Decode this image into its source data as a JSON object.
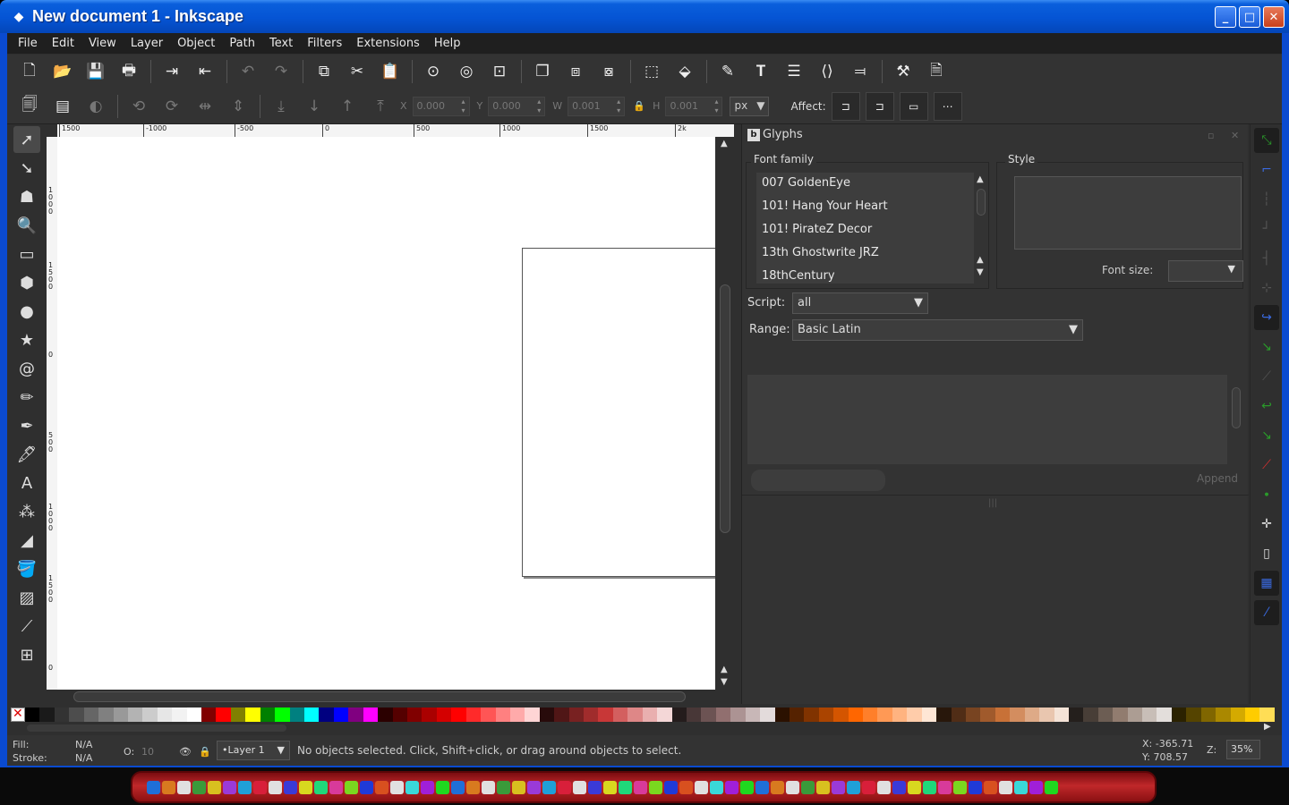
{
  "window": {
    "title": "New document 1 - Inkscape",
    "minimize": "_",
    "maximize": "□",
    "close": "✕"
  },
  "menu": [
    "File",
    "Edit",
    "View",
    "Layer",
    "Object",
    "Path",
    "Text",
    "Filters",
    "Extensions",
    "Help"
  ],
  "toolbar_main": [
    "new-icon",
    "open-icon",
    "save-icon",
    "print-icon",
    "import-icon",
    "export-icon",
    "undo-icon",
    "redo-icon",
    "copy-icon",
    "cut-icon",
    "paste-icon",
    "zoom-selection-icon",
    "zoom-drawing-icon",
    "zoom-page-icon",
    "duplicate-icon",
    "clone-icon",
    "unlink-clone-icon",
    "group-icon",
    "ungroup-icon",
    "fill-stroke-icon",
    "text-font-icon",
    "layers-icon",
    "xml-editor-icon",
    "align-icon",
    "preferences-icon",
    "document-properties-icon"
  ],
  "select_toolbar": {
    "x_label": "X",
    "x_value": "0.000",
    "y_label": "Y",
    "y_value": "0.000",
    "w_label": "W",
    "w_value": "0.001",
    "h_label": "H",
    "h_value": "0.001",
    "unit": "px",
    "affect_label": "Affect:"
  },
  "ruler": {
    "h_labels": [
      "1500",
      "-1000",
      "-500",
      "0",
      "500",
      "1000",
      "1500",
      "2k"
    ],
    "v_labels": [
      "1000",
      "1500",
      "0",
      "500",
      "1000",
      "1500",
      "0"
    ]
  },
  "glyphs": {
    "title": "Glyphs",
    "font_family_label": "Font family",
    "style_label": "Style",
    "fonts": [
      "007 GoldenEye",
      "101! Hang Your Heart",
      "101! PirateZ Decor",
      "13th Ghostwrite JRZ",
      "18thCentury"
    ],
    "font_size_label": "Font size:",
    "script_label": "Script:",
    "script_value": "all",
    "range_label": "Range:",
    "range_value": "Basic Latin",
    "append_label": "Append"
  },
  "status": {
    "fill_label": "Fill:",
    "fill_value": "N/A",
    "stroke_label": "Stroke:",
    "stroke_value": "N/A",
    "opacity_label": "O:",
    "opacity_value": "10",
    "layer": "•Layer 1",
    "message": "No objects selected. Click, Shift+click, or drag around objects to select.",
    "x_coord": "X: -365.71",
    "y_coord": "Y: 708.57",
    "zoom_label": "Z:",
    "zoom_value": "35%"
  },
  "palette": [
    "#000000",
    "#1a1a1a",
    "#333333",
    "#4d4d4d",
    "#666666",
    "#808080",
    "#999999",
    "#b3b3b3",
    "#cccccc",
    "#e6e6e6",
    "#f2f2f2",
    "#ffffff",
    "#800000",
    "#ff0000",
    "#808000",
    "#ffff00",
    "#008000",
    "#00ff00",
    "#008080",
    "#00ffff",
    "#000080",
    "#0000ff",
    "#800080",
    "#ff00ff",
    "#2b0000",
    "#550000",
    "#800000",
    "#aa0000",
    "#d40000",
    "#ff0000",
    "#ff2a2a",
    "#ff5555",
    "#ff8080",
    "#ffaaaa",
    "#ffd5d5",
    "#280b0b",
    "#501616",
    "#782121",
    "#a02c2c",
    "#c83737",
    "#d35f5f",
    "#de8787",
    "#e9afaf",
    "#f4d7d7",
    "#241c1c",
    "#483737",
    "#6c5353",
    "#916f6f",
    "#ac9393",
    "#c8b7b7",
    "#e3dbdb",
    "#2b1100",
    "#552200",
    "#803300",
    "#aa4400",
    "#d45500",
    "#ff6600",
    "#ff7f2a",
    "#ff9955",
    "#ffb380",
    "#ffccaa",
    "#ffe6d5",
    "#28170b",
    "#502d16",
    "#784421",
    "#a05a2c",
    "#c87137",
    "#d38d5f",
    "#deaa87",
    "#e9c6af",
    "#f4e3d7",
    "#241f1c",
    "#483e37",
    "#6c5d53",
    "#917c6f",
    "#ac9d93",
    "#c8beb7",
    "#e3dedb",
    "#2b2200",
    "#554400",
    "#806600",
    "#aa8800",
    "#d4aa00",
    "#ffcc00",
    "#ffdd55"
  ],
  "taskbar_colors": [
    "#1f6fd8",
    "#d87a1f",
    "#e0e0e0",
    "#3a9a3a",
    "#d8c01f",
    "#9a3ad8",
    "#1fa0d8",
    "#d81f3a",
    "#e0e0e0",
    "#3a3ad8",
    "#d8d81f",
    "#1fd87a",
    "#d83a9a",
    "#7ad81f",
    "#1f3ad8",
    "#d8501f",
    "#e0e0e0",
    "#3ad8d8",
    "#a01fd8",
    "#1fd81f"
  ]
}
